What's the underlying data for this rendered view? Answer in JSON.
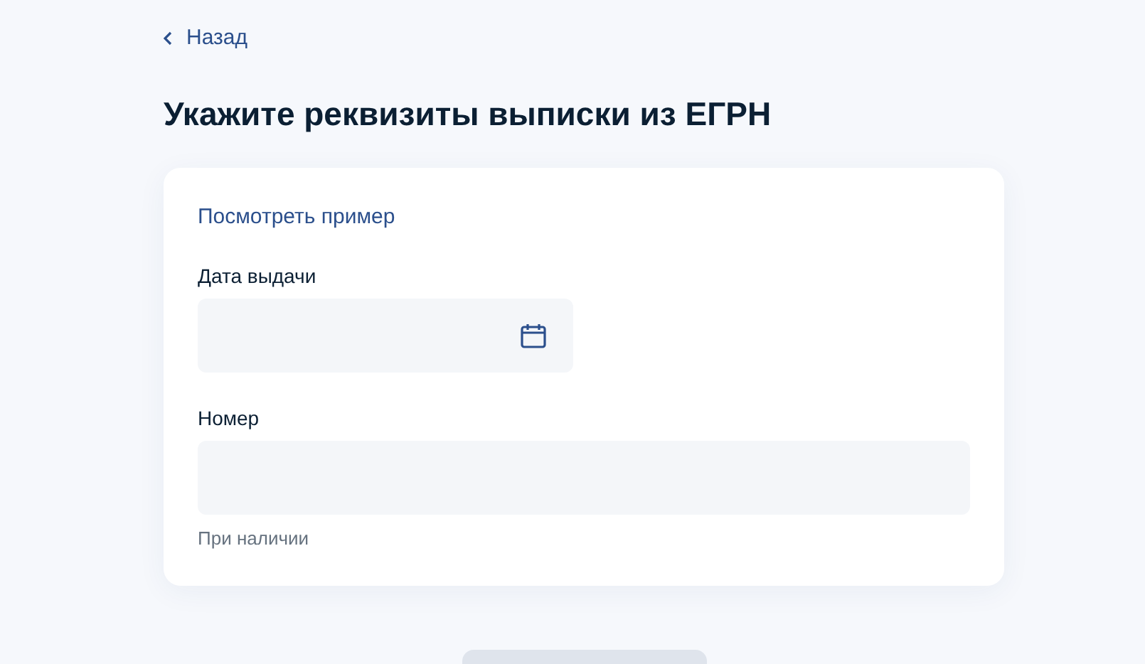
{
  "back_link": {
    "label": "Назад"
  },
  "title": "Укажите реквизиты выписки из ЕГРН",
  "form": {
    "example_link": "Посмотреть пример",
    "fields": [
      {
        "kind": "date",
        "label": "Дата выдачи"
      },
      {
        "kind": "text",
        "label": "Номер",
        "hint": "При наличии"
      }
    ]
  }
}
